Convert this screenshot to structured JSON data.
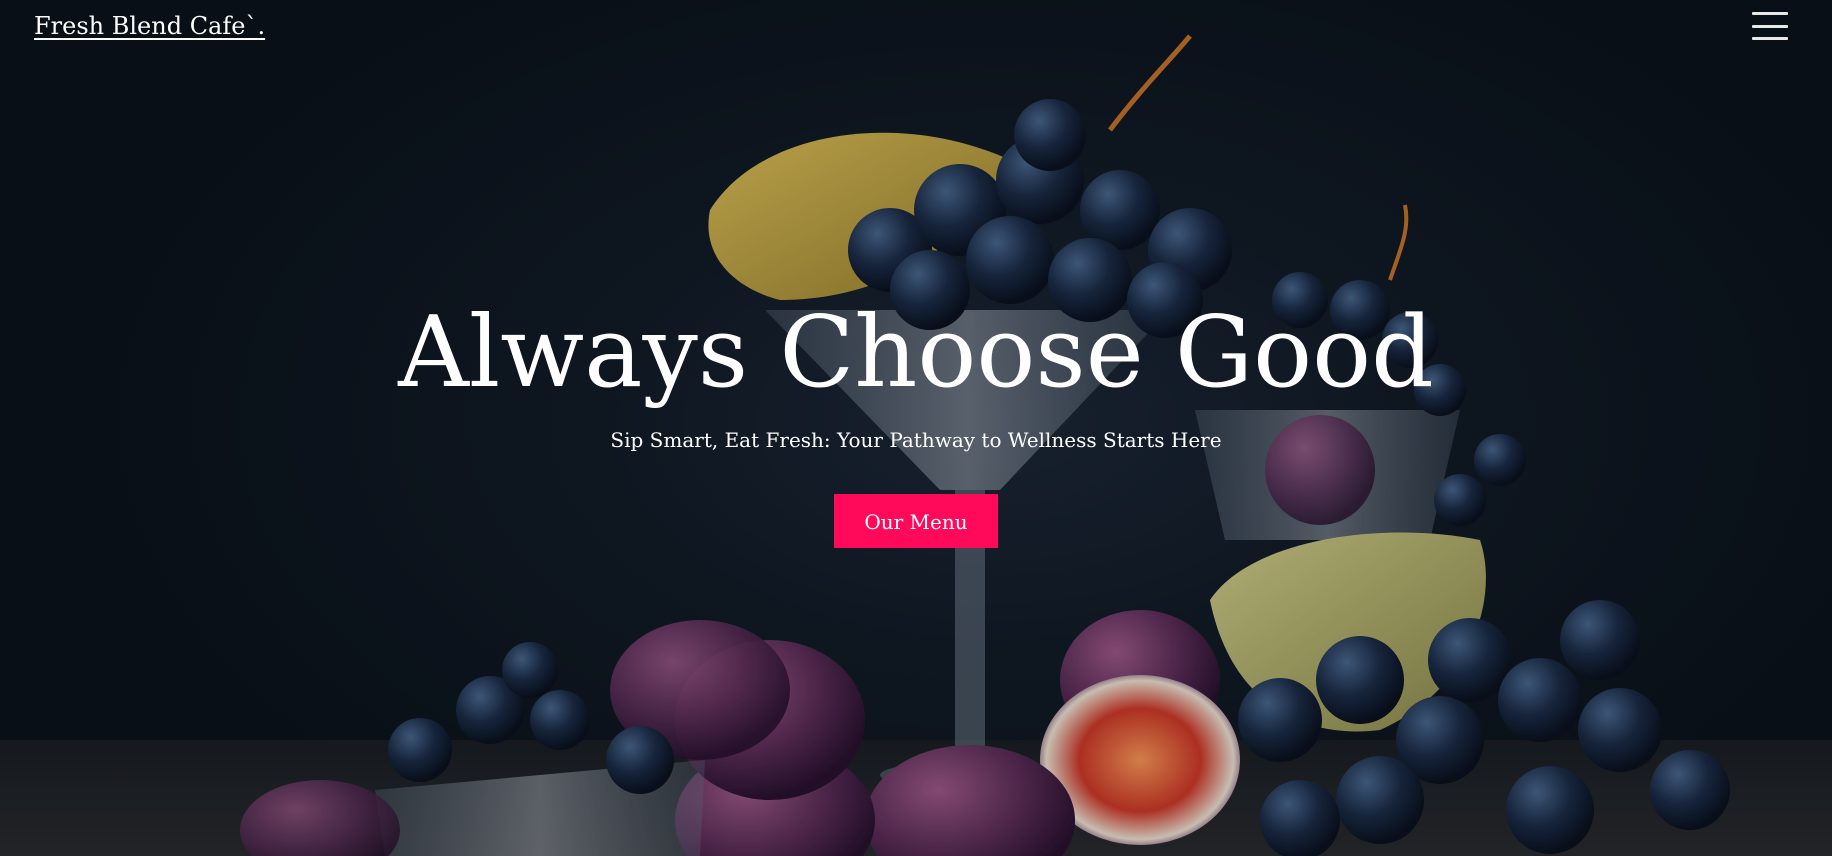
{
  "header": {
    "brand": "Fresh Blend Cafe`.",
    "menu_icon": "hamburger-menu-icon"
  },
  "hero": {
    "headline": "Always Choose Good",
    "tagline": "Sip Smart, Eat Fresh: Your Pathway to Wellness Starts Here",
    "cta_label": "Our Menu",
    "background_image": "grapes-figs-still-life"
  },
  "colors": {
    "cta_background": "#ff0a5a",
    "text": "#ffffff",
    "background": "#0d1620"
  }
}
